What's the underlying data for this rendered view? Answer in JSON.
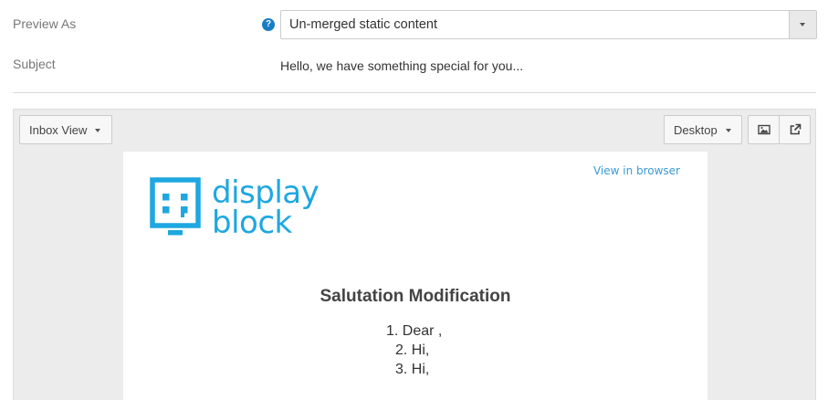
{
  "preview_as": {
    "label": "Preview As",
    "help_icon": "question-circle-icon",
    "selected_value": "Un-merged static content"
  },
  "subject": {
    "label": "Subject",
    "value": "Hello, we have something special for you..."
  },
  "toolbar": {
    "inbox_view_label": "Inbox View",
    "device_label": "Desktop",
    "images_icon": "image-icon",
    "popout_icon": "external-link-icon"
  },
  "email": {
    "view_in_browser": "View in browser",
    "logo": {
      "line1": "display",
      "line2": "block",
      "color": "#1ea7e1"
    },
    "heading": "Salutation Modification",
    "items": [
      {
        "number": "1.",
        "text": "Dear ,"
      },
      {
        "number": "2.",
        "text": "Hi,"
      },
      {
        "number": "3.",
        "text": "Hi,"
      }
    ]
  },
  "colors": {
    "accent": "#1a7dc4",
    "link": "#3a9ad9",
    "panel_background": "#ececec"
  }
}
